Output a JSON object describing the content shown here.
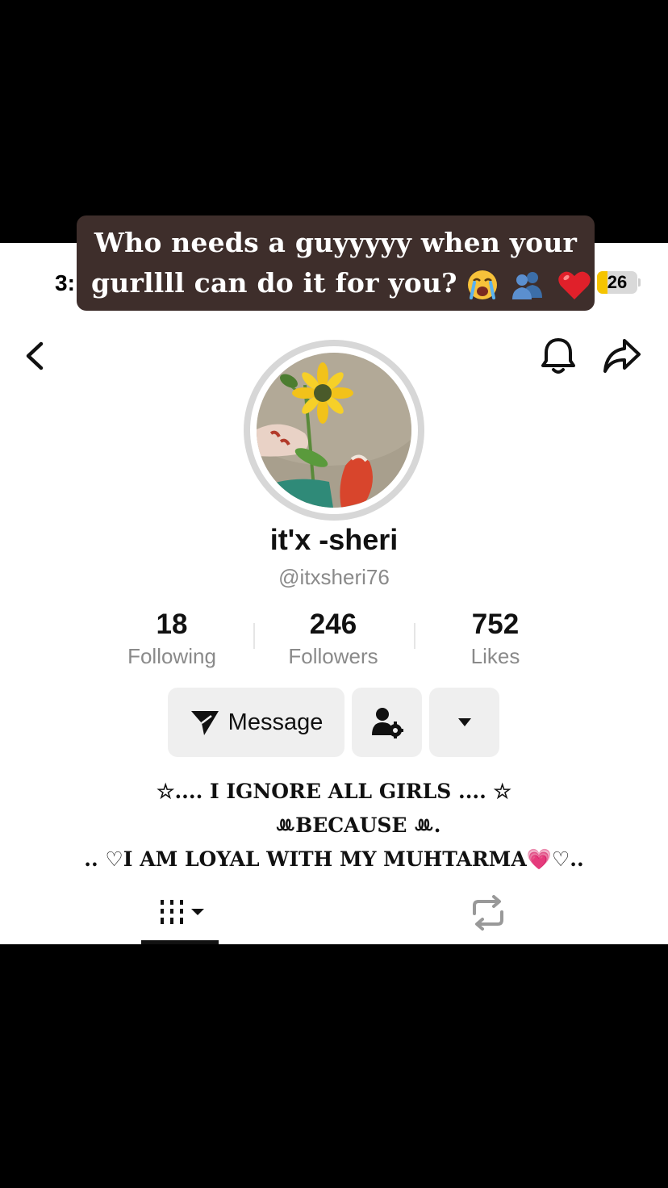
{
  "status_bar": {
    "time": "3:",
    "battery_level": "26",
    "battery_fraction": 0.26
  },
  "overlay_caption": {
    "line1": "Who needs a guyyyyy when your",
    "line2_text": "gurllll can do it for you?",
    "emojis": [
      "crying-face",
      "two-people",
      "red-heart"
    ]
  },
  "nav": {
    "back": "back-chevron-icon",
    "notifications": "bell-icon",
    "share": "share-arrow-icon"
  },
  "profile": {
    "display_name": "it'x -sheri",
    "username": "@itxsheri76",
    "stats": [
      {
        "value": "18",
        "label": "Following"
      },
      {
        "value": "246",
        "label": "Followers"
      },
      {
        "value": "752",
        "label": "Likes"
      }
    ],
    "actions": {
      "message_label": "Message"
    },
    "bio": {
      "line1": "☆.... I IGNORE ALL GIRLS .... ☆",
      "line2": "ꔛBECAUSE ꔛ.",
      "line3": ".. ♡I AM LOYAL WITH MY MUHTARMA💗♡.."
    }
  },
  "tabs": {
    "grid": "videos-grid-icon",
    "repost": "repost-icon"
  },
  "colors": {
    "caption_bg": "#3e2e2b",
    "battery": "#f5c400",
    "muted_text": "#8a8a8a",
    "button_bg": "#efefef"
  }
}
